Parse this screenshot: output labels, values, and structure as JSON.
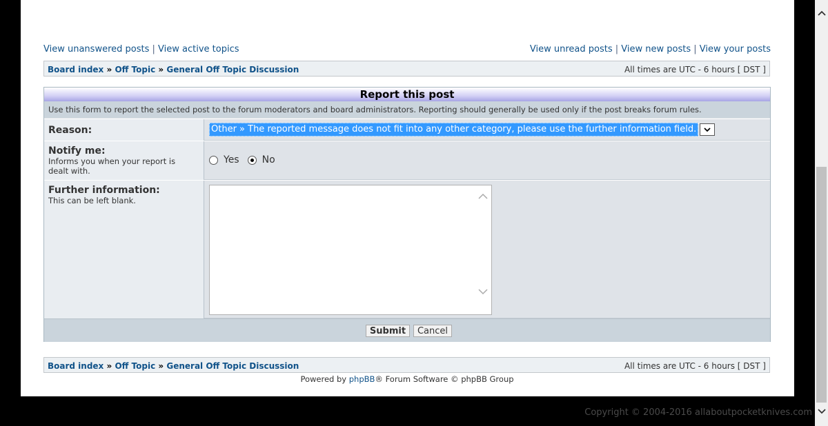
{
  "top_links": {
    "left": [
      "View unanswered posts",
      "View active topics"
    ],
    "right": [
      "View unread posts",
      "View new posts",
      "View your posts"
    ],
    "separator": "|"
  },
  "breadcrumb": {
    "items": [
      "Board index",
      "Off Topic",
      "General Off Topic Discussion"
    ],
    "separator": "»",
    "times": "All times are UTC - 6 hours [ DST ]"
  },
  "report": {
    "title": "Report this post",
    "description": "Use this form to report the selected post to the forum moderators and board administrators. Reporting should generally be used only if the post breaks forum rules.",
    "reason_label": "Reason:",
    "reason_value": "Other » The reported message does not fit into any other category, please use the further information field.",
    "notify_label": "Notify me:",
    "notify_desc": "Informs you when your report is dealt with.",
    "notify_yes": "Yes",
    "notify_no": "No",
    "notify_selected": "No",
    "further_label": "Further information:",
    "further_desc": "This can be left blank.",
    "further_value": "",
    "submit": "Submit",
    "cancel": "Cancel"
  },
  "footer": {
    "powered_prefix": "Powered by ",
    "powered_link": "phpBB",
    "powered_suffix": "® Forum Software © phpBB Group",
    "copyright": "Copyright © 2004-2016 allaboutpocketknives.com"
  }
}
